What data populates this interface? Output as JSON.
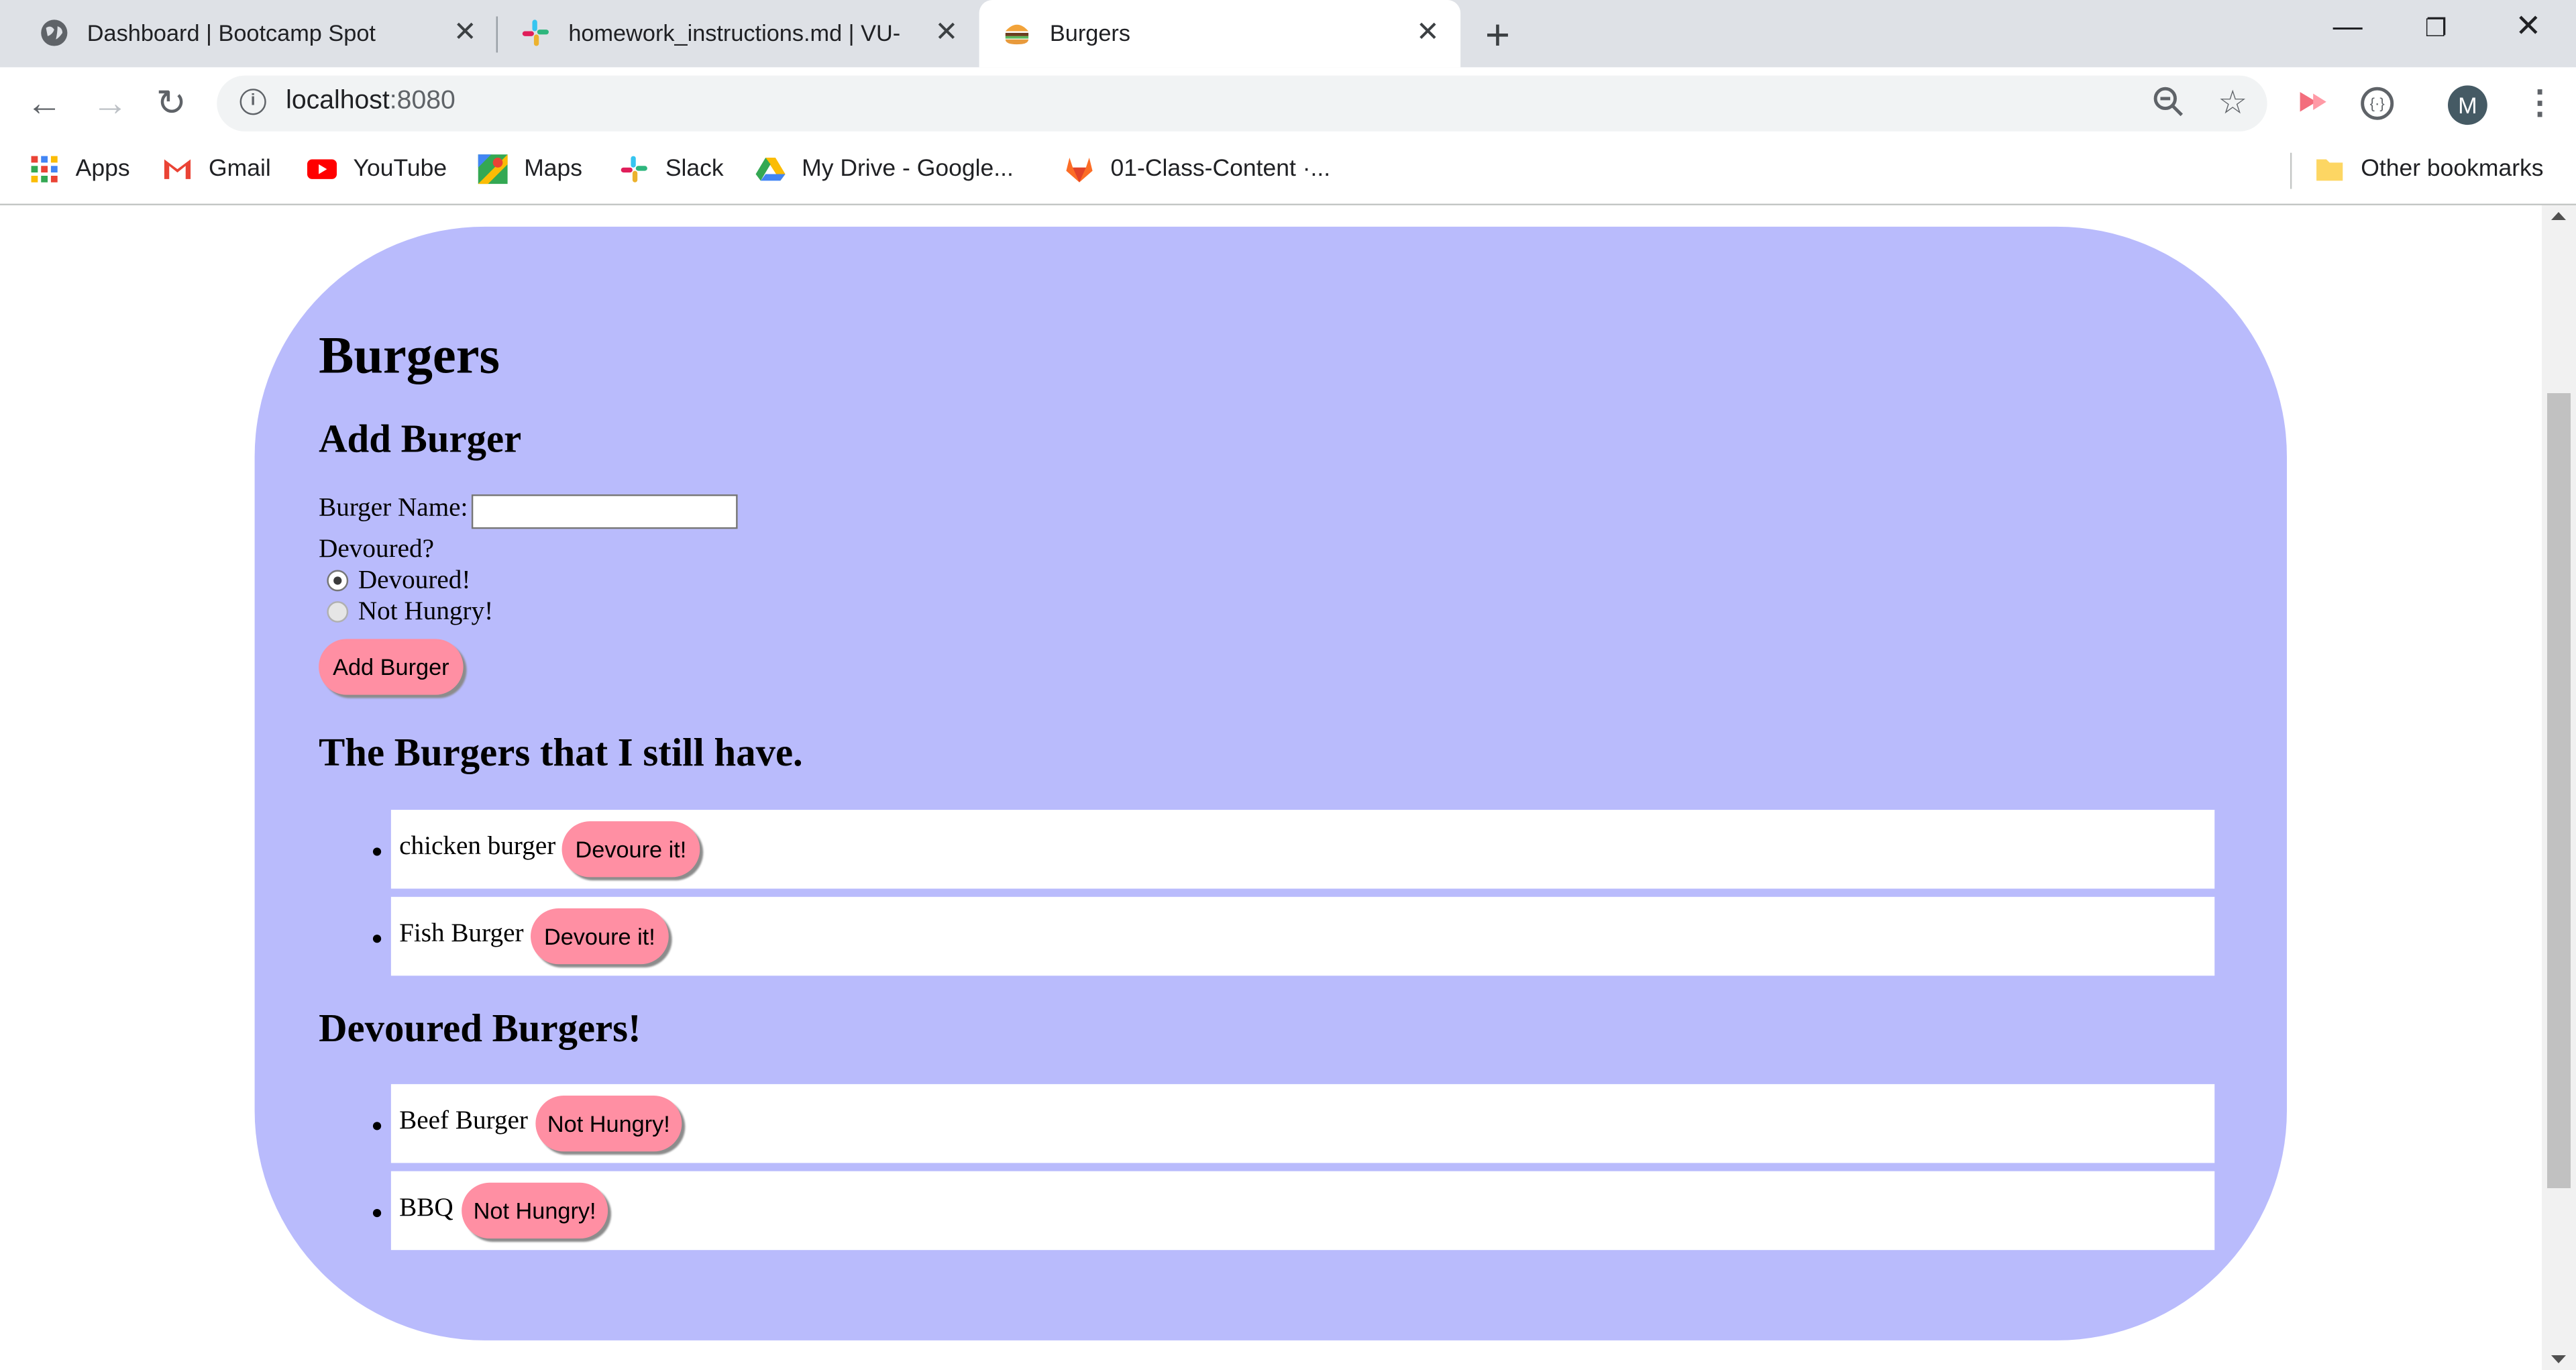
{
  "browser": {
    "tabs": [
      {
        "title": "Dashboard | Bootcamp Spot",
        "icon": "globe-icon"
      },
      {
        "title": "homework_instructions.md | VU-",
        "icon": "slack-icon"
      },
      {
        "title": "Burgers",
        "icon": "burger-icon",
        "active": true
      }
    ],
    "address": {
      "host": "localhost",
      "port": ":8080"
    },
    "profile_initial": "M",
    "bookmarks": [
      {
        "label": "Apps",
        "icon": "apps-grid-icon"
      },
      {
        "label": "Gmail",
        "icon": "gmail-icon"
      },
      {
        "label": "YouTube",
        "icon": "youtube-icon"
      },
      {
        "label": "Maps",
        "icon": "maps-icon"
      },
      {
        "label": "Slack",
        "icon": "slack-icon"
      },
      {
        "label": "My Drive - Google...",
        "icon": "google-drive-icon"
      },
      {
        "label": "01-Class-Content ·...",
        "icon": "gitlab-icon"
      }
    ],
    "other_bookmarks": "Other bookmarks"
  },
  "page": {
    "title": "Burgers",
    "add_section": {
      "heading": "Add Burger",
      "name_label": "Burger Name:",
      "name_value": "",
      "devoured_question": "Devoured?",
      "options": [
        "Devoured!",
        "Not Hungry!"
      ],
      "selected_option": "Devoured!",
      "submit_label": "Add Burger"
    },
    "have_section": {
      "heading": "The Burgers that I still have.",
      "items": [
        {
          "name": "chicken burger",
          "action": "Devoure it!"
        },
        {
          "name": "Fish Burger",
          "action": "Devoure it!"
        }
      ]
    },
    "devoured_section": {
      "heading": "Devoured Burgers!",
      "items": [
        {
          "name": "Beef Burger",
          "action": "Not Hungry!"
        },
        {
          "name": "BBQ",
          "action": "Not Hungry!"
        }
      ]
    }
  },
  "colors": {
    "card_background": "#b9bbfc",
    "button_background": "#ff8fa3",
    "row_background": "#ffffff",
    "tabstrip": "#dee1e6"
  }
}
